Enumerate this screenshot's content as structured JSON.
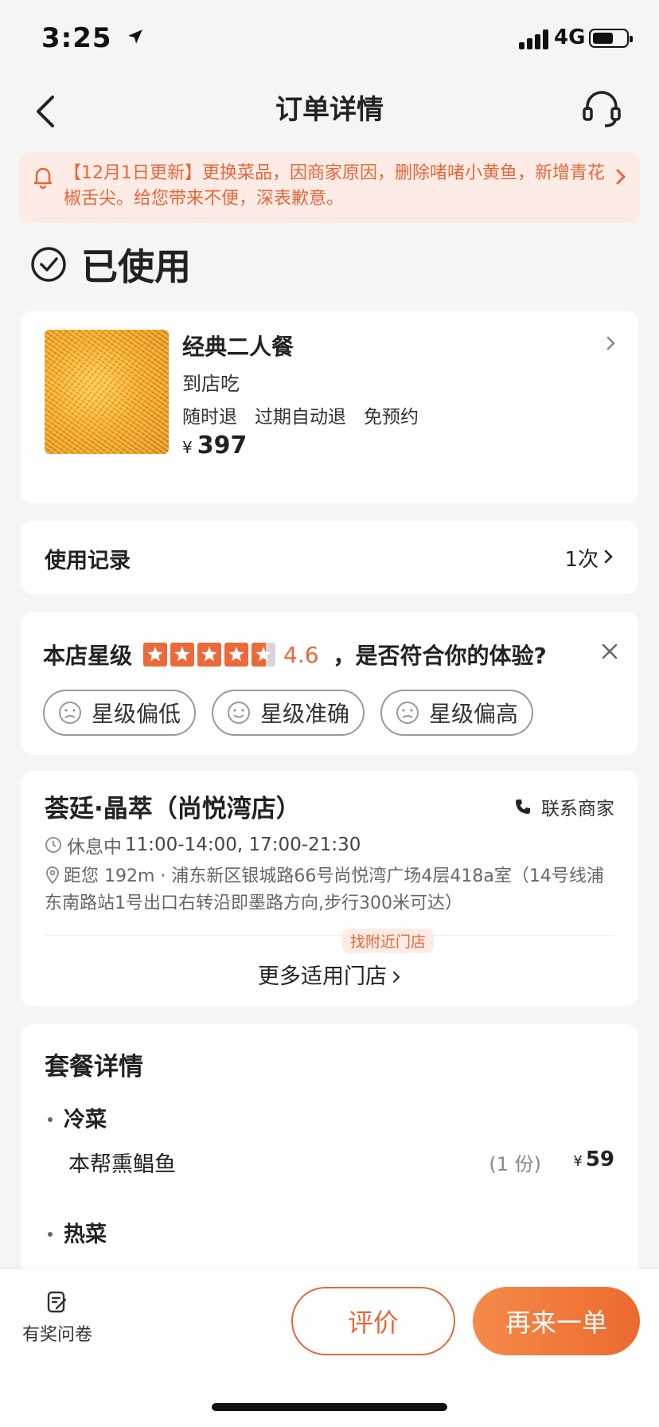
{
  "status_bar": {
    "time": "3:25",
    "network": "4G"
  },
  "nav": {
    "title": "订单详情"
  },
  "notice": {
    "text": "【12月1日更新】更换菜品，因商家原因，删除啫啫小黄鱼，新增青花椒舌尖。给您带来不便，深表歉意。"
  },
  "order_status": "已使用",
  "deal": {
    "name": "经典二人餐",
    "mode": "到店吃",
    "tags": [
      "随时退",
      "过期自动退",
      "免预约"
    ],
    "currency": "¥",
    "price": "397"
  },
  "usage_record": {
    "label": "使用记录",
    "value": "1次"
  },
  "rating": {
    "label": "本店星级",
    "score": "4.6",
    "stars": 4.6,
    "question": "，是否符合你的体验?",
    "options": [
      "星级偏低",
      "星级准确",
      "星级偏高"
    ]
  },
  "store": {
    "name": "荟廷·晶萃（尚悦湾店）",
    "contact_label": "联系商家",
    "hours_status": "休息中",
    "hours": "11:00-14:00, 17:00-21:30",
    "address": "距您 192m · 浦东新区银城路66号尚悦湾广场4层418a室（14号线浦东南路站1号出口右转沿即墨路方向,步行300米可达）",
    "nearby_badge": "找附近门店",
    "more_stores": "更多适用门店"
  },
  "package": {
    "title": "套餐详情",
    "categories": [
      {
        "name": "冷菜",
        "items": [
          {
            "name": "本帮熏鲳鱼",
            "qty": "(1 份)",
            "price": "59"
          }
        ]
      },
      {
        "name": "热菜",
        "items": []
      }
    ],
    "currency": "¥"
  },
  "bottom": {
    "survey_label": "有奖问卷",
    "review_label": "评价",
    "reorder_label": "再来一单"
  },
  "colors": {
    "accent": "#e8663a",
    "notice_bg": "#fdece6",
    "page_bg": "#f5f5f5"
  }
}
